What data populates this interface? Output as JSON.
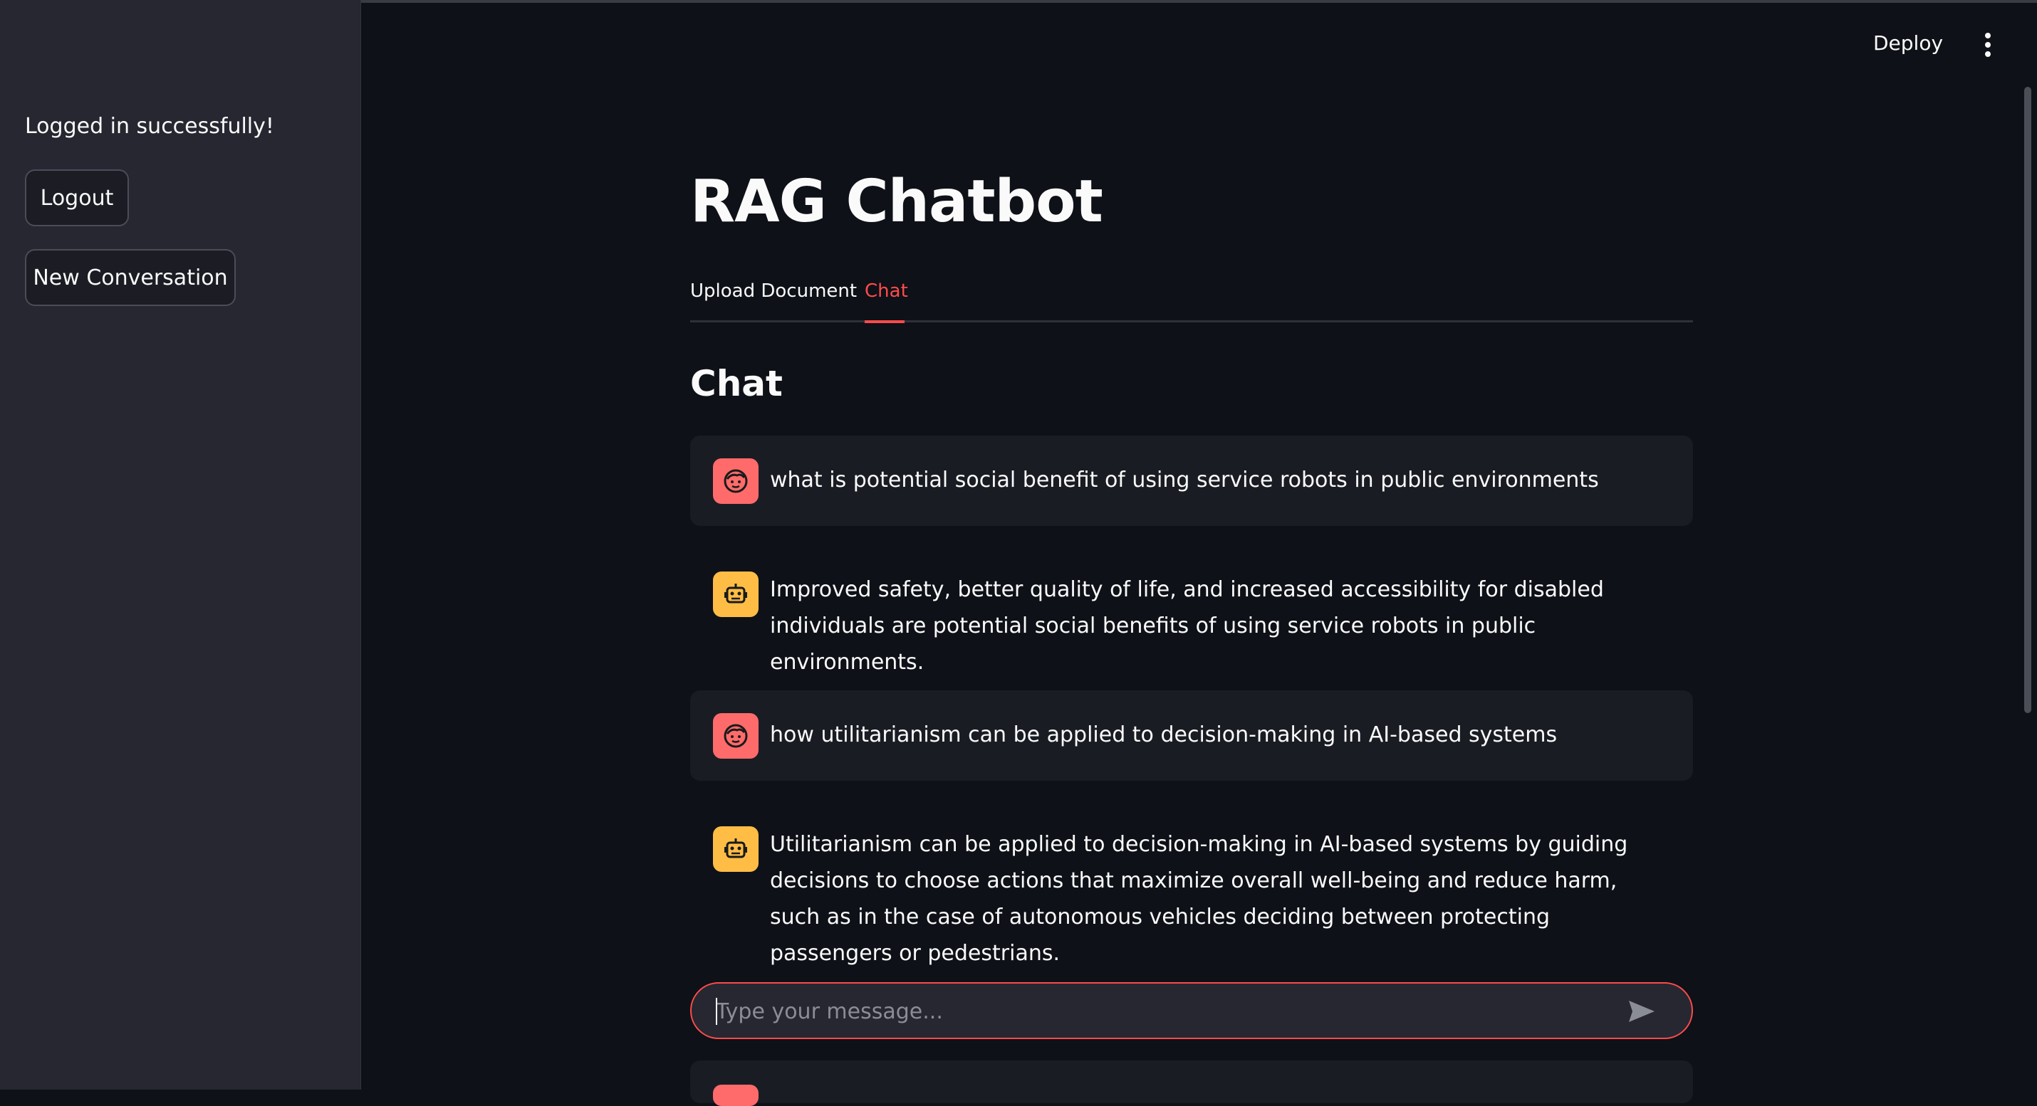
{
  "sidebar": {
    "status_text": "Logged in successfully!",
    "logout_label": "Logout",
    "new_conversation_label": "New Conversation"
  },
  "header": {
    "deploy_label": "Deploy",
    "menu_icon": "kebab-menu-icon"
  },
  "main": {
    "title": "RAG Chatbot",
    "tabs": [
      {
        "label": "Upload Document",
        "active": false
      },
      {
        "label": "Chat",
        "active": true
      }
    ],
    "section_title": "Chat",
    "messages": [
      {
        "role": "user",
        "avatar_icon": "user-face-icon",
        "text": "what is potential social benefit of using service robots in public environments"
      },
      {
        "role": "assistant",
        "avatar_icon": "robot-icon",
        "text": "Improved safety, better quality of life, and increased accessibility for disabled individuals are potential social benefits of using service robots in public environments."
      },
      {
        "role": "user",
        "avatar_icon": "user-face-icon",
        "text": "how utilitarianism can be applied to decision-making in AI-based systems"
      },
      {
        "role": "assistant",
        "avatar_icon": "robot-icon",
        "text": "Utilitarianism can be applied to decision-making in AI-based systems by guiding decisions to choose actions that maximize overall well-being and reduce harm, such as in the case of autonomous vehicles deciding between protecting passengers or pedestrians."
      }
    ],
    "chat_input": {
      "placeholder": "Type your message...",
      "value": "",
      "send_icon": "send-icon"
    }
  },
  "colors": {
    "accent": "#ff4b4b",
    "user_avatar": "#ff6b6b",
    "bot_avatar": "#ffbd45",
    "sidebar_bg": "#262730",
    "main_bg": "#0e1117"
  }
}
